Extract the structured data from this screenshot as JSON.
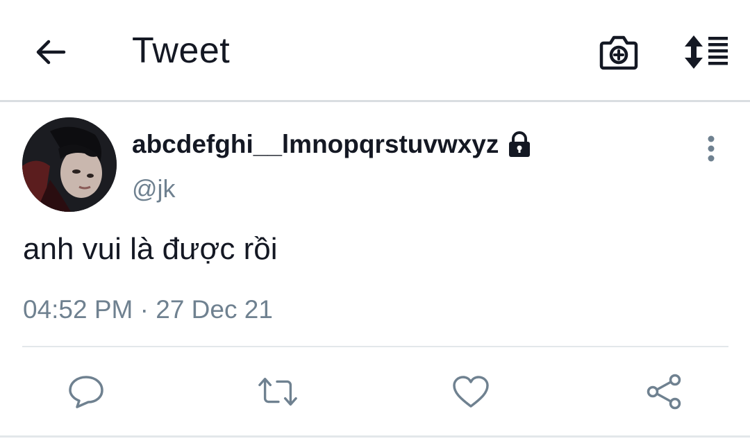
{
  "header": {
    "title": "Tweet",
    "back_icon": "arrow-left-icon",
    "camera_icon": "camera-plus-icon",
    "sort_icon": "sort-list-icon"
  },
  "tweet": {
    "display_name": "abcdefghi__lmnopqrstuvwxyz",
    "protected_icon": "lock-icon",
    "handle": "@jk",
    "text": "anh vui là được rồi",
    "timestamp": "04:52 PM · 27 Dec 21",
    "more_icon": "vertical-dots-icon"
  },
  "actions": [
    {
      "name": "reply",
      "icon": "speech-bubble-icon"
    },
    {
      "name": "retweet",
      "icon": "retweet-icon"
    },
    {
      "name": "like",
      "icon": "heart-icon"
    },
    {
      "name": "share",
      "icon": "share-icon"
    }
  ],
  "colors": {
    "text": "#141823",
    "secondary_text": "#6f8190",
    "icon": "#6f8190",
    "divider": "#e3e7ea"
  }
}
